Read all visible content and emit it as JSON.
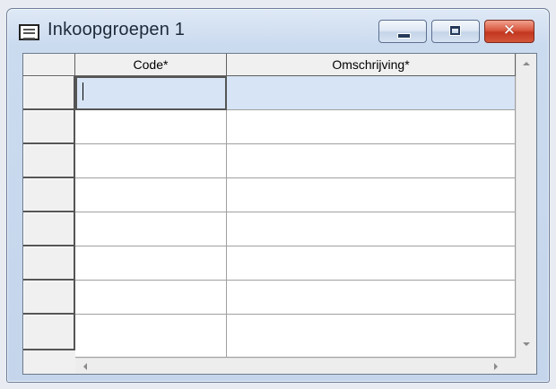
{
  "window": {
    "title": "Inkoopgroepen 1",
    "icon": "grid-window-icon",
    "controls": {
      "minimize": "minimize-icon",
      "maximize": "maximize-icon",
      "close": "close-icon",
      "close_glyph": "✕"
    }
  },
  "grid": {
    "columns": [
      {
        "header": "Code*"
      },
      {
        "header": "Omschrijving*"
      }
    ],
    "rows": [
      {
        "code": "",
        "omschrijving": ""
      },
      {
        "code": "",
        "omschrijving": ""
      },
      {
        "code": "",
        "omschrijving": ""
      },
      {
        "code": "",
        "omschrijving": ""
      },
      {
        "code": "",
        "omschrijving": ""
      },
      {
        "code": "",
        "omschrijving": ""
      },
      {
        "code": "",
        "omschrijving": ""
      }
    ],
    "selected_row": 1,
    "active_cell": "code"
  },
  "colors": {
    "selection": "#d6e4f5",
    "close_button": "#c2371f",
    "title_bar": "#cbdbef"
  }
}
